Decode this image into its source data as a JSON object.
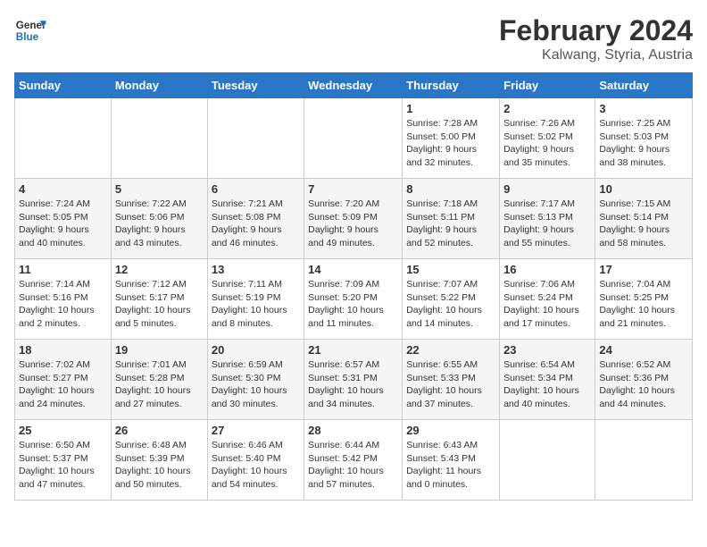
{
  "header": {
    "logo_line1": "General",
    "logo_line2": "Blue",
    "month": "February 2024",
    "location": "Kalwang, Styria, Austria"
  },
  "weekdays": [
    "Sunday",
    "Monday",
    "Tuesday",
    "Wednesday",
    "Thursday",
    "Friday",
    "Saturday"
  ],
  "weeks": [
    [
      {
        "day": "",
        "info": ""
      },
      {
        "day": "",
        "info": ""
      },
      {
        "day": "",
        "info": ""
      },
      {
        "day": "",
        "info": ""
      },
      {
        "day": "1",
        "info": "Sunrise: 7:28 AM\nSunset: 5:00 PM\nDaylight: 9 hours\nand 32 minutes."
      },
      {
        "day": "2",
        "info": "Sunrise: 7:26 AM\nSunset: 5:02 PM\nDaylight: 9 hours\nand 35 minutes."
      },
      {
        "day": "3",
        "info": "Sunrise: 7:25 AM\nSunset: 5:03 PM\nDaylight: 9 hours\nand 38 minutes."
      }
    ],
    [
      {
        "day": "4",
        "info": "Sunrise: 7:24 AM\nSunset: 5:05 PM\nDaylight: 9 hours\nand 40 minutes."
      },
      {
        "day": "5",
        "info": "Sunrise: 7:22 AM\nSunset: 5:06 PM\nDaylight: 9 hours\nand 43 minutes."
      },
      {
        "day": "6",
        "info": "Sunrise: 7:21 AM\nSunset: 5:08 PM\nDaylight: 9 hours\nand 46 minutes."
      },
      {
        "day": "7",
        "info": "Sunrise: 7:20 AM\nSunset: 5:09 PM\nDaylight: 9 hours\nand 49 minutes."
      },
      {
        "day": "8",
        "info": "Sunrise: 7:18 AM\nSunset: 5:11 PM\nDaylight: 9 hours\nand 52 minutes."
      },
      {
        "day": "9",
        "info": "Sunrise: 7:17 AM\nSunset: 5:13 PM\nDaylight: 9 hours\nand 55 minutes."
      },
      {
        "day": "10",
        "info": "Sunrise: 7:15 AM\nSunset: 5:14 PM\nDaylight: 9 hours\nand 58 minutes."
      }
    ],
    [
      {
        "day": "11",
        "info": "Sunrise: 7:14 AM\nSunset: 5:16 PM\nDaylight: 10 hours\nand 2 minutes."
      },
      {
        "day": "12",
        "info": "Sunrise: 7:12 AM\nSunset: 5:17 PM\nDaylight: 10 hours\nand 5 minutes."
      },
      {
        "day": "13",
        "info": "Sunrise: 7:11 AM\nSunset: 5:19 PM\nDaylight: 10 hours\nand 8 minutes."
      },
      {
        "day": "14",
        "info": "Sunrise: 7:09 AM\nSunset: 5:20 PM\nDaylight: 10 hours\nand 11 minutes."
      },
      {
        "day": "15",
        "info": "Sunrise: 7:07 AM\nSunset: 5:22 PM\nDaylight: 10 hours\nand 14 minutes."
      },
      {
        "day": "16",
        "info": "Sunrise: 7:06 AM\nSunset: 5:24 PM\nDaylight: 10 hours\nand 17 minutes."
      },
      {
        "day": "17",
        "info": "Sunrise: 7:04 AM\nSunset: 5:25 PM\nDaylight: 10 hours\nand 21 minutes."
      }
    ],
    [
      {
        "day": "18",
        "info": "Sunrise: 7:02 AM\nSunset: 5:27 PM\nDaylight: 10 hours\nand 24 minutes."
      },
      {
        "day": "19",
        "info": "Sunrise: 7:01 AM\nSunset: 5:28 PM\nDaylight: 10 hours\nand 27 minutes."
      },
      {
        "day": "20",
        "info": "Sunrise: 6:59 AM\nSunset: 5:30 PM\nDaylight: 10 hours\nand 30 minutes."
      },
      {
        "day": "21",
        "info": "Sunrise: 6:57 AM\nSunset: 5:31 PM\nDaylight: 10 hours\nand 34 minutes."
      },
      {
        "day": "22",
        "info": "Sunrise: 6:55 AM\nSunset: 5:33 PM\nDaylight: 10 hours\nand 37 minutes."
      },
      {
        "day": "23",
        "info": "Sunrise: 6:54 AM\nSunset: 5:34 PM\nDaylight: 10 hours\nand 40 minutes."
      },
      {
        "day": "24",
        "info": "Sunrise: 6:52 AM\nSunset: 5:36 PM\nDaylight: 10 hours\nand 44 minutes."
      }
    ],
    [
      {
        "day": "25",
        "info": "Sunrise: 6:50 AM\nSunset: 5:37 PM\nDaylight: 10 hours\nand 47 minutes."
      },
      {
        "day": "26",
        "info": "Sunrise: 6:48 AM\nSunset: 5:39 PM\nDaylight: 10 hours\nand 50 minutes."
      },
      {
        "day": "27",
        "info": "Sunrise: 6:46 AM\nSunset: 5:40 PM\nDaylight: 10 hours\nand 54 minutes."
      },
      {
        "day": "28",
        "info": "Sunrise: 6:44 AM\nSunset: 5:42 PM\nDaylight: 10 hours\nand 57 minutes."
      },
      {
        "day": "29",
        "info": "Sunrise: 6:43 AM\nSunset: 5:43 PM\nDaylight: 11 hours\nand 0 minutes."
      },
      {
        "day": "",
        "info": ""
      },
      {
        "day": "",
        "info": ""
      }
    ]
  ]
}
